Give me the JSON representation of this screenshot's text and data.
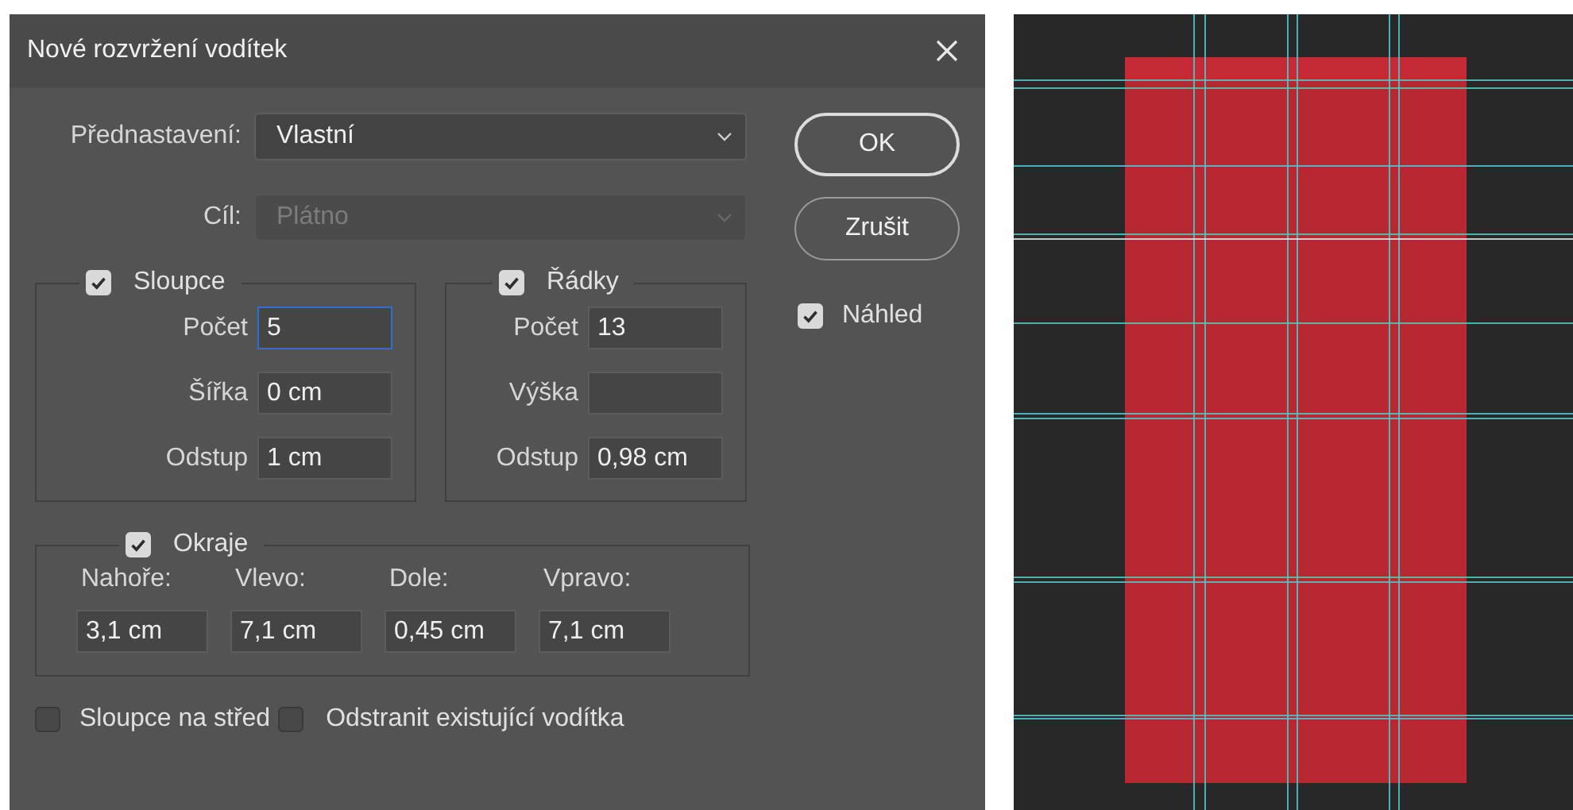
{
  "window": {
    "title": "Nové rozvržení vodítek"
  },
  "preset": {
    "label": "Přednastavení:",
    "value": "Vlastní",
    "disabled": false
  },
  "target": {
    "label": "Cíl:",
    "value": "Plátno",
    "disabled": true
  },
  "buttons": [
    {
      "label": "OK",
      "kind": "default"
    },
    {
      "label": "Zrušit",
      "kind": "normal"
    }
  ],
  "preview": {
    "label": "Náhled",
    "checked": true
  },
  "columns": {
    "label": "Sloupce",
    "checked": true,
    "fields": [
      {
        "label": "Počet",
        "value": "5",
        "focused": true
      },
      {
        "label": "Šířka",
        "value": "0 cm",
        "focused": false
      },
      {
        "label": "Odstup",
        "value": "1 cm",
        "focused": false
      }
    ]
  },
  "rows": {
    "label": "Řádky",
    "checked": true,
    "fields": [
      {
        "label": "Počet",
        "value": "13",
        "focused": false
      },
      {
        "label": "Výška",
        "focused": false
      },
      {
        "label": "Odstup",
        "value": "0,98 cm",
        "focused": false
      }
    ]
  },
  "margins": {
    "label": "Okraje",
    "checked": true,
    "fields": [
      {
        "label": "Nahoře:",
        "value": "3,1 cm"
      },
      {
        "label": "Vlevo:",
        "value": "7,1 cm"
      },
      {
        "label": "Dole:",
        "value": "0,45 cm"
      },
      {
        "label": "Vpravo:",
        "value": "7,1 cm"
      }
    ]
  },
  "options": [
    {
      "label": "Sloupce na střed",
      "checked": false
    },
    {
      "label": "Odstranit existující vodítka",
      "checked": false
    }
  ]
}
